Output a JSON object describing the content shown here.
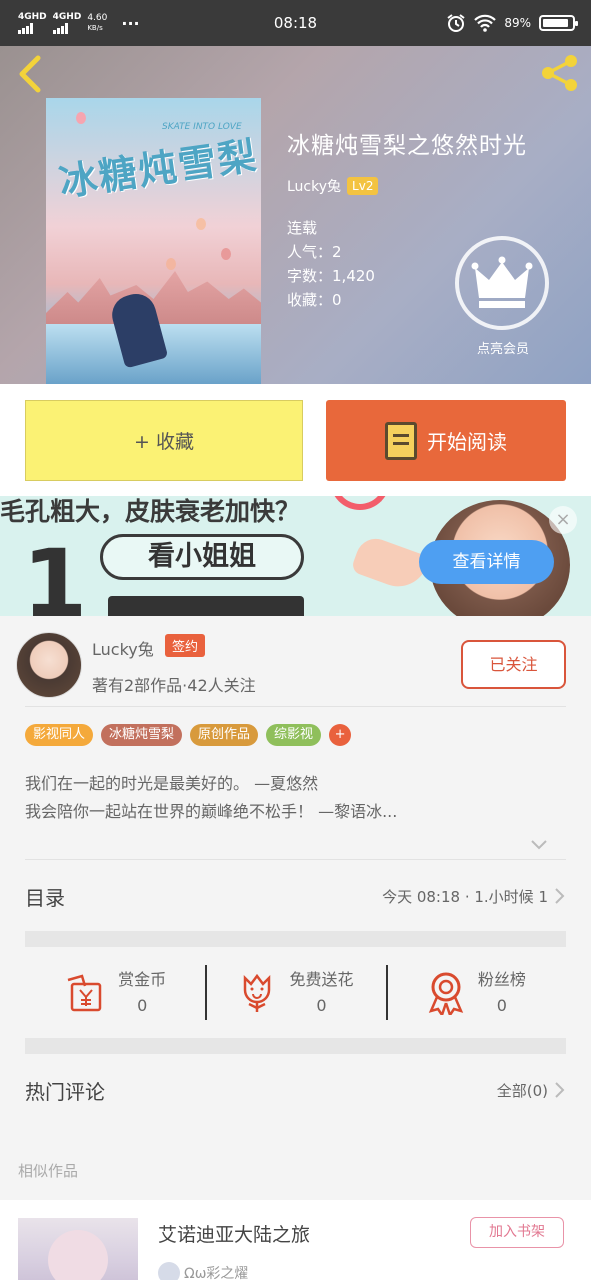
{
  "status_bar": {
    "network_1": "4GHD",
    "network_2": "4GHD",
    "speed": "4.60",
    "speed_unit": "KB/s",
    "dots": "···",
    "time": "08:18",
    "battery": "89%"
  },
  "book": {
    "title": "冰糖炖雪梨之悠然时光",
    "author": "Lucky兔",
    "level": "Lv2",
    "status": "连载",
    "popularity_label": "人气：",
    "popularity": "2",
    "words_label": "字数：",
    "words": "1,420",
    "favorites_label": "收藏：",
    "favorites": "0",
    "vip_label": "点亮会员",
    "cover_title": "冰糖炖雪梨",
    "cover_subtitle": "SKATE INTO LOVE"
  },
  "actions": {
    "favorite_label": "+ 收藏",
    "read_label": "开始阅读"
  },
  "ad": {
    "headline": "毛孔粗大，皮肤衰老加快？",
    "number": "1",
    "pill_text": "看小姐姐",
    "cta": "查看详情",
    "close": "×"
  },
  "author": {
    "name": "Lucky兔",
    "badge": "签约",
    "works": "著有2部作品·42人关注",
    "follow_label": "已关注"
  },
  "tags": [
    {
      "label": "影视同人",
      "color": "#f4a93b"
    },
    {
      "label": "冰糖炖雪梨",
      "color": "#c2705d"
    },
    {
      "label": "原创作品",
      "color": "#d89a3c"
    },
    {
      "label": "综影视",
      "color": "#8fbf5b"
    },
    {
      "label": "+",
      "color": "#e9613d"
    }
  ],
  "intro": {
    "line1": "我们在一起的时光是最美好的。 —夏悠然",
    "line2": "我会陪你一起站在世界的巅峰绝不松手！ —黎语冰..."
  },
  "catalog": {
    "label": "目录",
    "update": "今天 08:18 · 1.小时候 1"
  },
  "stats": [
    {
      "label": "赏金币",
      "value": "0",
      "icon": "coin-envelope-icon"
    },
    {
      "label": "免费送花",
      "value": "0",
      "icon": "flower-icon"
    },
    {
      "label": "粉丝榜",
      "value": "0",
      "icon": "medal-icon"
    }
  ],
  "comments": {
    "label": "热门评论",
    "all": "全部(0)"
  },
  "similar": {
    "section_label": "相似作品",
    "title": "艾诺迪亚大陆之旅",
    "add_label": "加入书架",
    "author": "Ωω彩之燿"
  },
  "colors": {
    "accent_orange": "#e8683b",
    "favorite_yellow": "#fbf274",
    "follow_red": "#d9553b"
  }
}
